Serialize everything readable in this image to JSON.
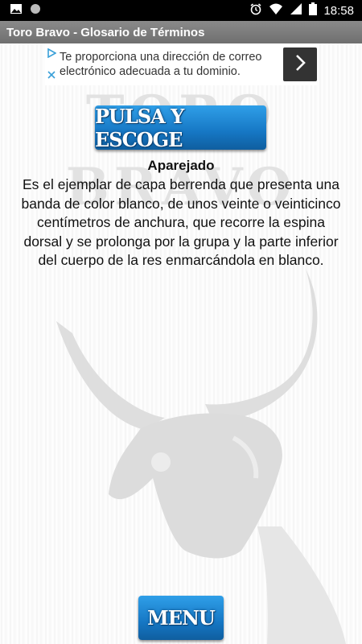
{
  "status_bar": {
    "time": "18:58",
    "icons": [
      "image-icon",
      "circle-icon",
      "alarm-icon",
      "wifi-icon",
      "signal-icon",
      "battery-icon"
    ]
  },
  "app_bar": {
    "title": "Toro Bravo - Glosario de Términos"
  },
  "ad": {
    "text": "Te proporciona una dirección de correo electrónico adecuada a tu dominio.",
    "icons": [
      "ad-choices-icon",
      "ad-close-icon",
      "chevron-right-icon"
    ]
  },
  "watermark": {
    "text": "TORO BRAVO"
  },
  "pulsa_button": {
    "label": "PULSA Y ESCOGE"
  },
  "term": {
    "title": "Aparejado",
    "definition": "Es el ejemplar de capa berrenda que presenta una banda de color blanco, de unos veinte o veinticinco centímetros de anchura, que recorre la espina dorsal y se prolonga por la grupa y la parte inferior del cuerpo de la res enmarcándola en blanco."
  },
  "menu_button": {
    "label": "MENU"
  },
  "colors": {
    "status_bar": "#000000",
    "app_bar": "#7d7d7d",
    "button": "#1a7cc8",
    "ad_arrow_bg": "#333333",
    "watermark": "#dcdcdc"
  }
}
